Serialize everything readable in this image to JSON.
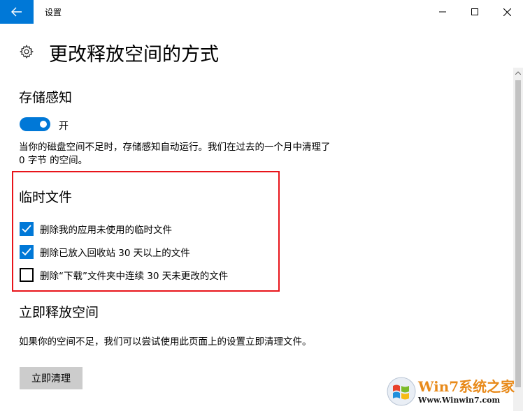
{
  "window": {
    "title": "设置",
    "back_icon": "arrow-left-icon",
    "controls": [
      "minimize-icon",
      "maximize-icon",
      "close-icon"
    ]
  },
  "page": {
    "icon": "gear-icon",
    "title": "更改释放空间的方式"
  },
  "storage_sense": {
    "heading": "存储感知",
    "toggle_state": "on",
    "toggle_label": "开",
    "description": "当你的磁盘空间不足时，存储感知自动运行。我们在过去的一个月中清理了 0 字节 的空间。"
  },
  "temp_files": {
    "heading": "临时文件",
    "options": [
      {
        "label": "删除我的应用未使用的临时文件",
        "checked": true
      },
      {
        "label": "删除已放入回收站 30 天以上的文件",
        "checked": true
      },
      {
        "label": "删除“下载”文件夹中连续 30 天未更改的文件",
        "checked": false
      }
    ]
  },
  "free_space": {
    "heading": "立即释放空间",
    "description": "如果你的空间不足，我们可以尝试使用此页面上的设置立即清理文件。",
    "button_label": "立即清理"
  },
  "watermark": {
    "line1": "Win7系统之家",
    "line2": "Www.Winwin7.com"
  },
  "colors": {
    "accent": "#0078d7",
    "highlight_box": "#e8141a",
    "button_bg": "#cccccc"
  }
}
